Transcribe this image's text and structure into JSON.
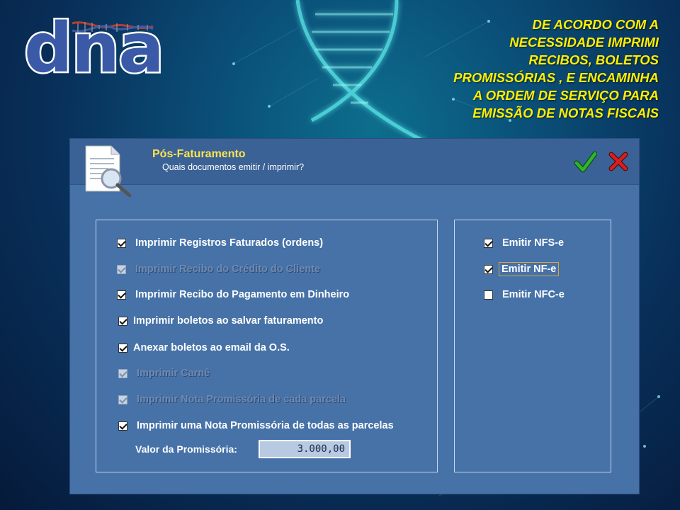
{
  "logo": {
    "text": "dna"
  },
  "caption": "DE ACORDO COM A\nNECESSIDADE  IMPRIMI\nRECIBOS, BOLETOS\nPROMISSÓRIAS , E ENCAMINHA\nA ORDEM DE SERVIÇO PARA\nEMISSÃO DE NOTAS FISCAIS",
  "dialog": {
    "title": "Pós-Faturamento",
    "subtitle": "Quais documentos emitir / imprimir?",
    "header_icon": "document-search-icon",
    "ok_icon": "green-check-icon",
    "cancel_icon": "red-x-icon"
  },
  "left_options": [
    {
      "label": "Imprimir Registros Faturados (ordens)",
      "checked": true,
      "enabled": true
    },
    {
      "label": "Imprimir Recibo do Crédito do Cliente",
      "checked": true,
      "enabled": false
    },
    {
      "label": "Imprimir Recibo do Pagamento em Dinheiro",
      "checked": true,
      "enabled": true
    },
    {
      "label": "Imprimir boletos ao salvar faturamento",
      "checked": true,
      "enabled": true
    },
    {
      "label": "Anexar boletos ao email da O.S.",
      "checked": true,
      "enabled": true
    },
    {
      "label": "Imprimir Carnê",
      "checked": true,
      "enabled": false
    },
    {
      "label": "Imprimir Nota Promissória de cada parcela",
      "checked": true,
      "enabled": false
    },
    {
      "label": "Imprimir uma Nota Promissória de todas as parcelas",
      "checked": true,
      "enabled": true
    }
  ],
  "valor": {
    "label": "Valor da Promissória:",
    "value": "3.000,00"
  },
  "right_options": [
    {
      "label": "Emitir NFS-e",
      "checked": true,
      "enabled": true
    },
    {
      "label": "Emitir NF-e",
      "checked": true,
      "enabled": true,
      "focused": true
    },
    {
      "label": "Emitir NFC-e",
      "checked": false,
      "enabled": true
    }
  ],
  "colors": {
    "title": "#ffe34d",
    "caption": "#ffee00",
    "dialog_bg": "#4672a8",
    "ok": "#1f9a1f",
    "cancel": "#c41a1a"
  }
}
